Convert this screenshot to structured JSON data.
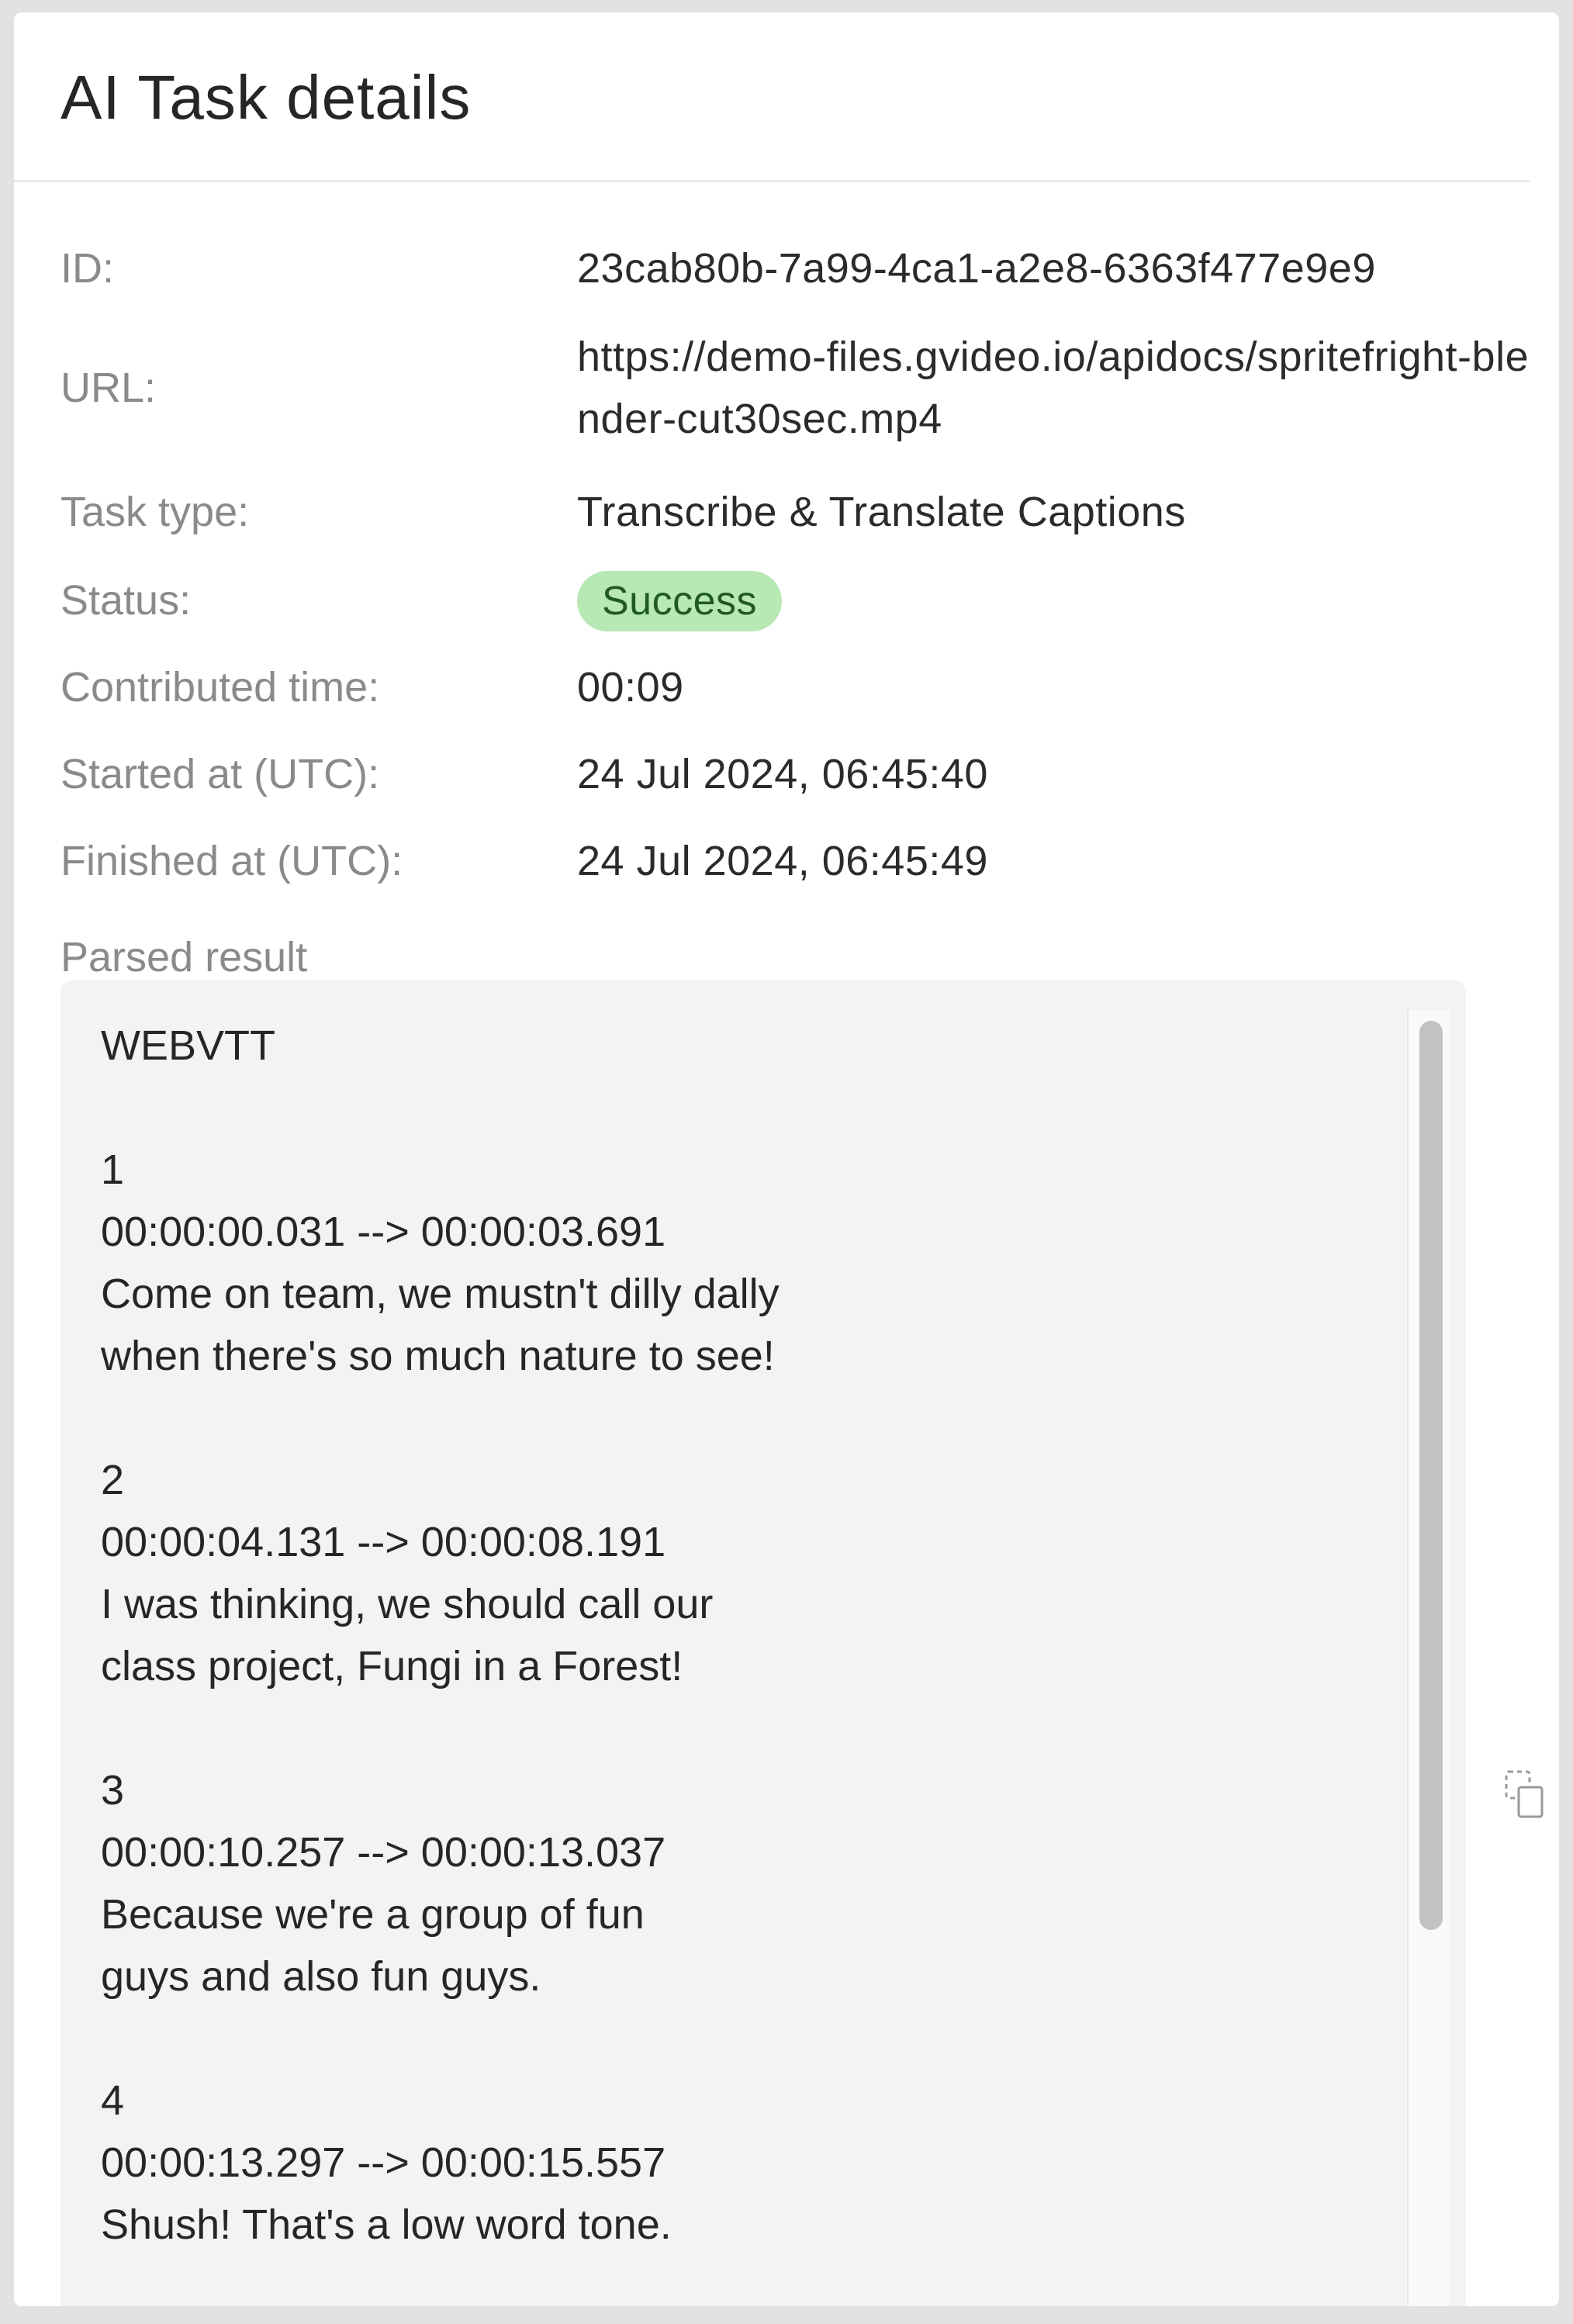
{
  "header": {
    "title": "AI Task details"
  },
  "details": {
    "id_label": "ID:",
    "id_value": "23cab80b-7a99-4ca1-a2e8-6363f477e9e9",
    "url_label": "URL:",
    "url_value": "https://demo-files.gvideo.io/apidocs/spritefright-blender-cut30sec.mp4",
    "task_type_label": "Task type:",
    "task_type_value": "Transcribe & Translate Captions",
    "status_label": "Status:",
    "status_value": "Success",
    "contributed_label": "Contributed time:",
    "contributed_value": "00:09",
    "started_label": "Started at (UTC):",
    "started_value": "24 Jul 2024, 06:45:40",
    "finished_label": "Finished at (UTC):",
    "finished_value": "24 Jul 2024, 06:45:49"
  },
  "parsed": {
    "label": "Parsed result",
    "text": "WEBVTT\n\n1\n00:00:00.031 --> 00:00:03.691\nCome on team, we mustn't dilly dally\nwhen there's so much nature to see!\n\n2\n00:00:04.131 --> 00:00:08.191\nI was thinking, we should call our\nclass project, Fungi in a Forest!\n\n3\n00:00:10.257 --> 00:00:13.037\nBecause we're a group of fun\nguys and also fun guys.\n\n4\n00:00:13.297 --> 00:00:15.557\nShush! That's a low word tone."
  },
  "icons": {
    "copy": "copy-icon"
  },
  "colors": {
    "status_success_bg": "#b8e8b4",
    "status_success_text": "#1f5a25"
  }
}
